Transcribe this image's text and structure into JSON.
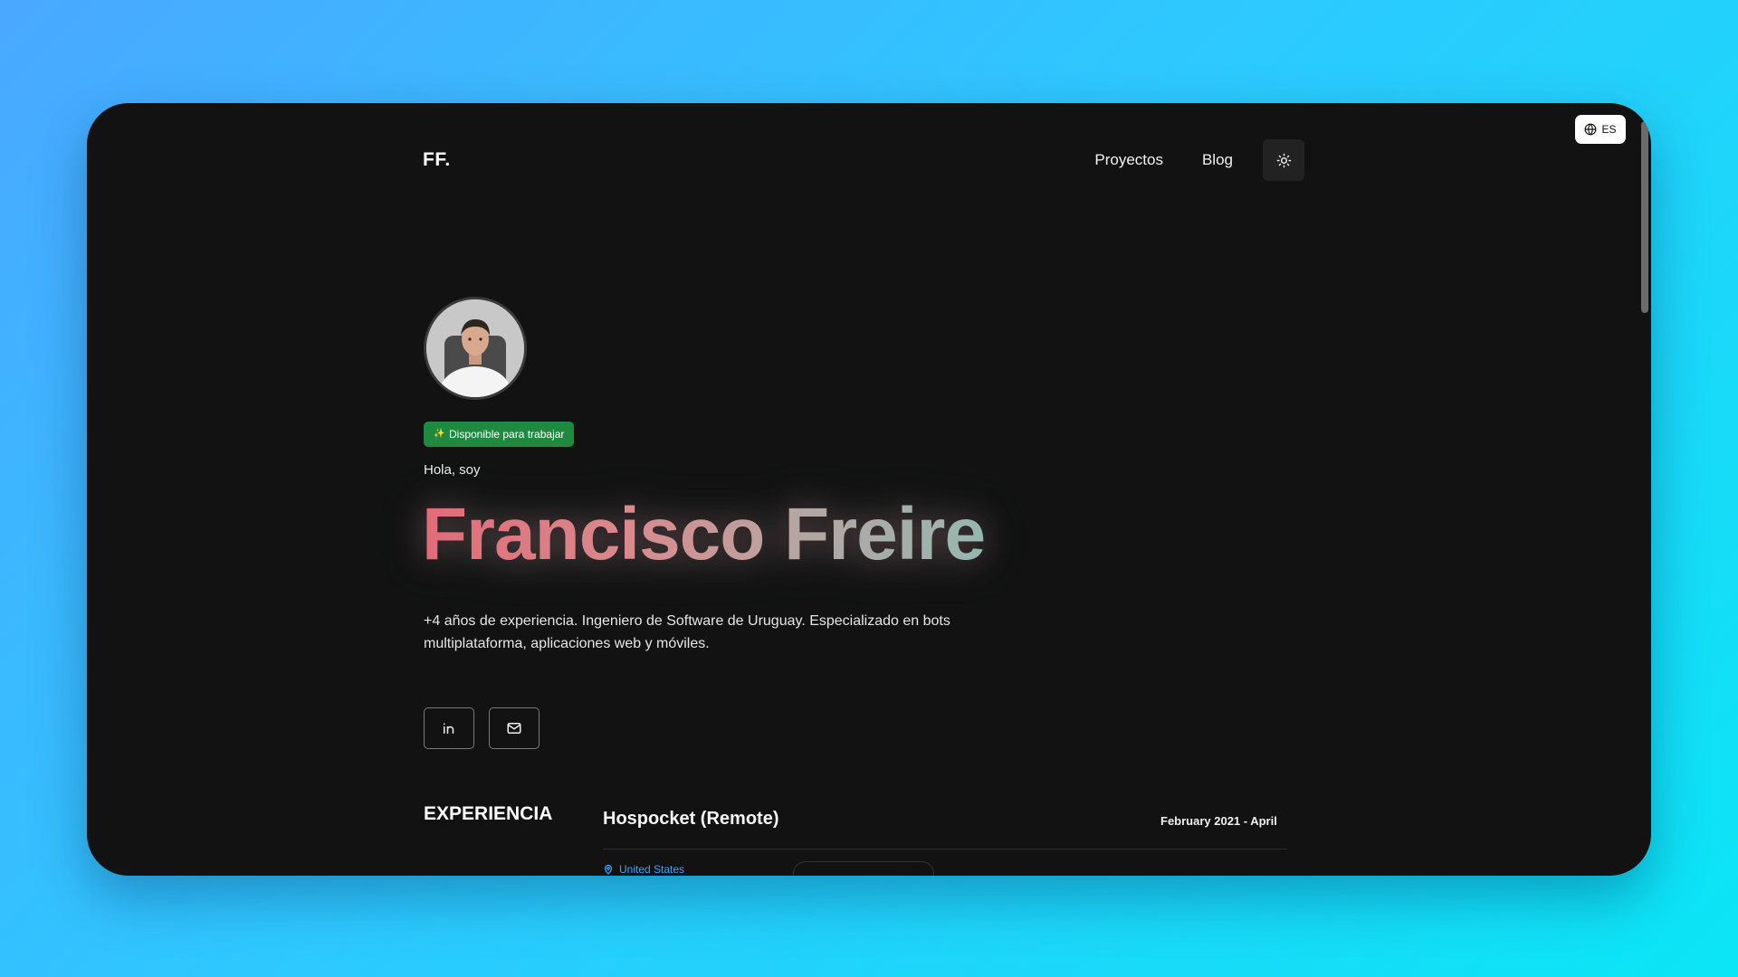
{
  "language_toggle": {
    "label": "ES",
    "icon": "globe-icon"
  },
  "nav": {
    "logo": "FF.",
    "links": [
      "Proyectos",
      "Blog"
    ],
    "theme_icon": "sun-icon"
  },
  "hero": {
    "status_badge": "Disponible para trabajar",
    "greeting": "Hola, soy",
    "name": "Francisco Freire",
    "description": "+4 años de experiencia. Ingeniero de Software de Uruguay. Especializado en bots multiplataforma, aplicaciones web y móviles.",
    "socials": [
      {
        "name": "linkedin",
        "icon": "linkedin-icon"
      },
      {
        "name": "email",
        "icon": "mail-icon"
      }
    ]
  },
  "experience": {
    "section_title": "EXPERIENCIA",
    "jobs": [
      {
        "title": "Hospocket (Remote)",
        "dates": "February 2021 - April",
        "location": "United States"
      }
    ]
  },
  "colors": {
    "page_bg": "#121212",
    "badge_bg": "#1f8a3f",
    "location_text": "#3ea4ff",
    "name_gradient_start": "#e06b78",
    "name_gradient_end": "#97b6b0"
  }
}
